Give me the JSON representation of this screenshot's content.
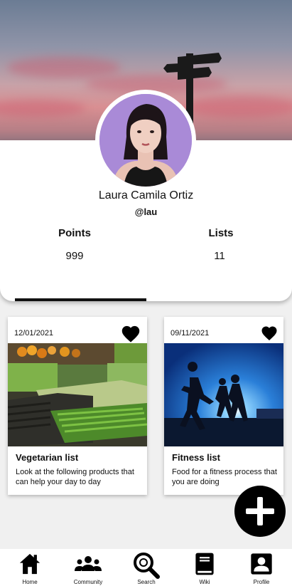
{
  "profile": {
    "name": "Laura Camila Ortiz",
    "handle": "@lau"
  },
  "stats": {
    "points_label": "Points",
    "points_value": "999",
    "lists_label": "Lists",
    "lists_value": "11"
  },
  "cards": [
    {
      "date": "12/01/2021",
      "title": "Vegetarian list",
      "description": "Look at the following products that can help your day to day",
      "favorited": true
    },
    {
      "date": "09/11/2021",
      "title": "Fitness list",
      "description": "Food for a fitness process that you are doing",
      "favorited": true
    }
  ],
  "bottom_nav": [
    {
      "label": "Home",
      "icon": "home-icon"
    },
    {
      "label": "Community",
      "icon": "community-icon"
    },
    {
      "label": "Search",
      "icon": "search-icon"
    },
    {
      "label": "Wiki",
      "icon": "book-icon"
    },
    {
      "label": "Profile",
      "icon": "profile-icon"
    }
  ],
  "fab": {
    "icon": "plus-icon"
  }
}
